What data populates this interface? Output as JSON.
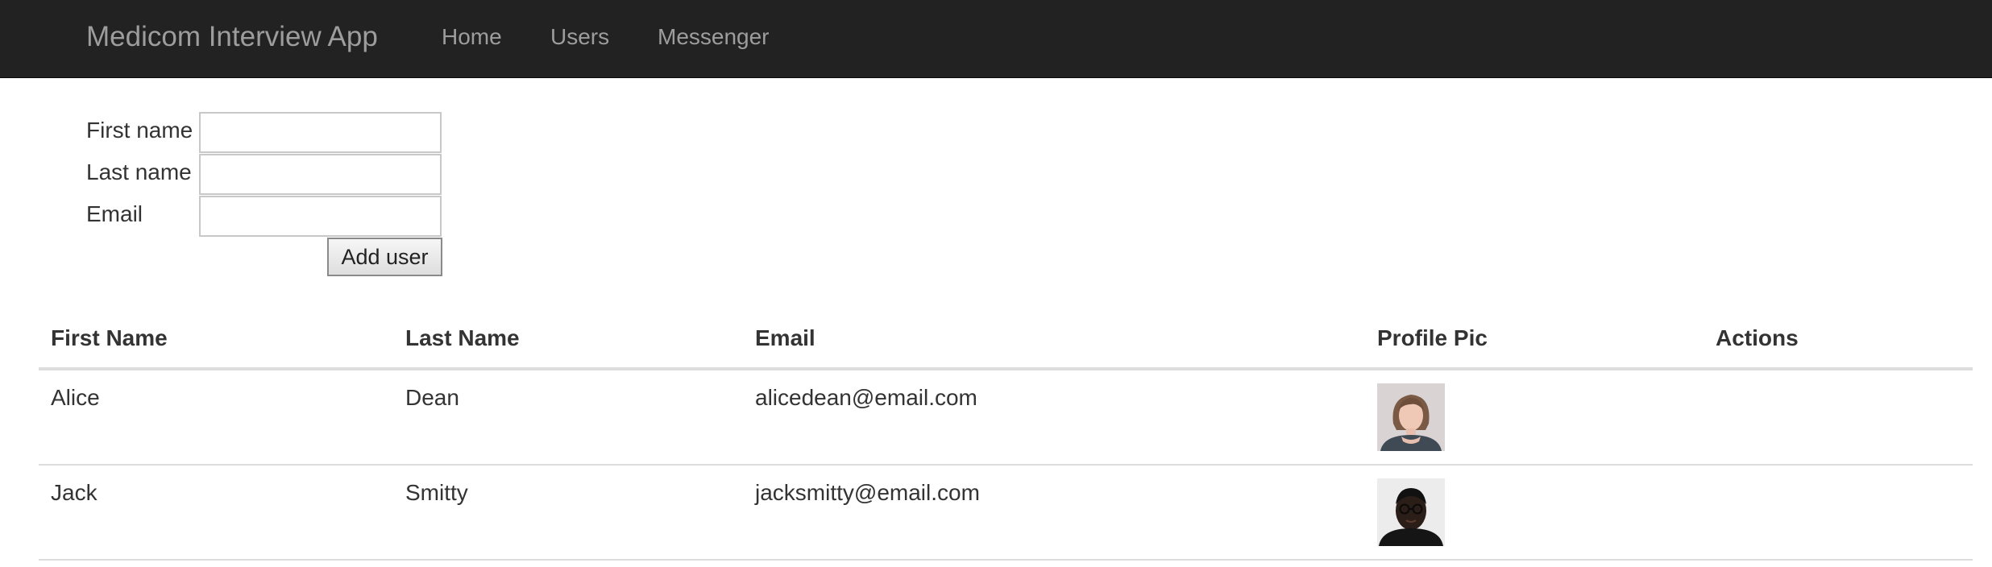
{
  "navbar": {
    "brand": "Medicom Interview App",
    "links": [
      "Home",
      "Users",
      "Messenger"
    ],
    "background": "#222222",
    "link_color": "#9d9d9d"
  },
  "form": {
    "first_name_label": "First name",
    "last_name_label": "Last name",
    "email_label": "Email",
    "first_name_value": "",
    "last_name_value": "",
    "email_value": "",
    "submit_label": "Add user"
  },
  "table": {
    "headers": [
      "First Name",
      "Last Name",
      "Email",
      "Profile Pic",
      "Actions"
    ],
    "rows": [
      {
        "first_name": "Alice",
        "last_name": "Dean",
        "email": "alicedean@email.com",
        "avatar": "woman-portrait",
        "actions": ""
      },
      {
        "first_name": "Jack",
        "last_name": "Smitty",
        "email": "jacksmitty@email.com",
        "avatar": "man-portrait",
        "actions": ""
      }
    ]
  }
}
